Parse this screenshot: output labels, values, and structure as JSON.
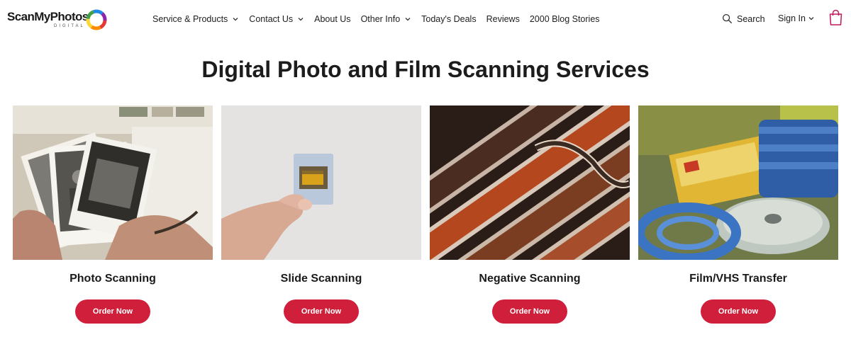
{
  "header": {
    "logo_text": "ScanMyPhotos",
    "logo_sub": "DIGITAL",
    "nav": [
      {
        "label": "Service & Products",
        "dropdown": true
      },
      {
        "label": "Contact Us",
        "dropdown": true
      },
      {
        "label": "About Us",
        "dropdown": false
      },
      {
        "label": "Other Info",
        "dropdown": true
      },
      {
        "label": "Today's Deals",
        "dropdown": false
      },
      {
        "label": "Reviews",
        "dropdown": false
      },
      {
        "label": "2000 Blog Stories",
        "dropdown": false
      }
    ],
    "search_label": "Search",
    "signin_label": "Sign In"
  },
  "page_title": "Digital Photo and Film Scanning Services",
  "cards": [
    {
      "label": "Photo Scanning",
      "button": "Order Now"
    },
    {
      "label": "Slide Scanning",
      "button": "Order Now"
    },
    {
      "label": "Negative Scanning",
      "button": "Order Now"
    },
    {
      "label": "Film/VHS Transfer",
      "button": "Order Now"
    }
  ],
  "colors": {
    "button": "#cf1f3a",
    "cart_icon": "#c2185b"
  }
}
